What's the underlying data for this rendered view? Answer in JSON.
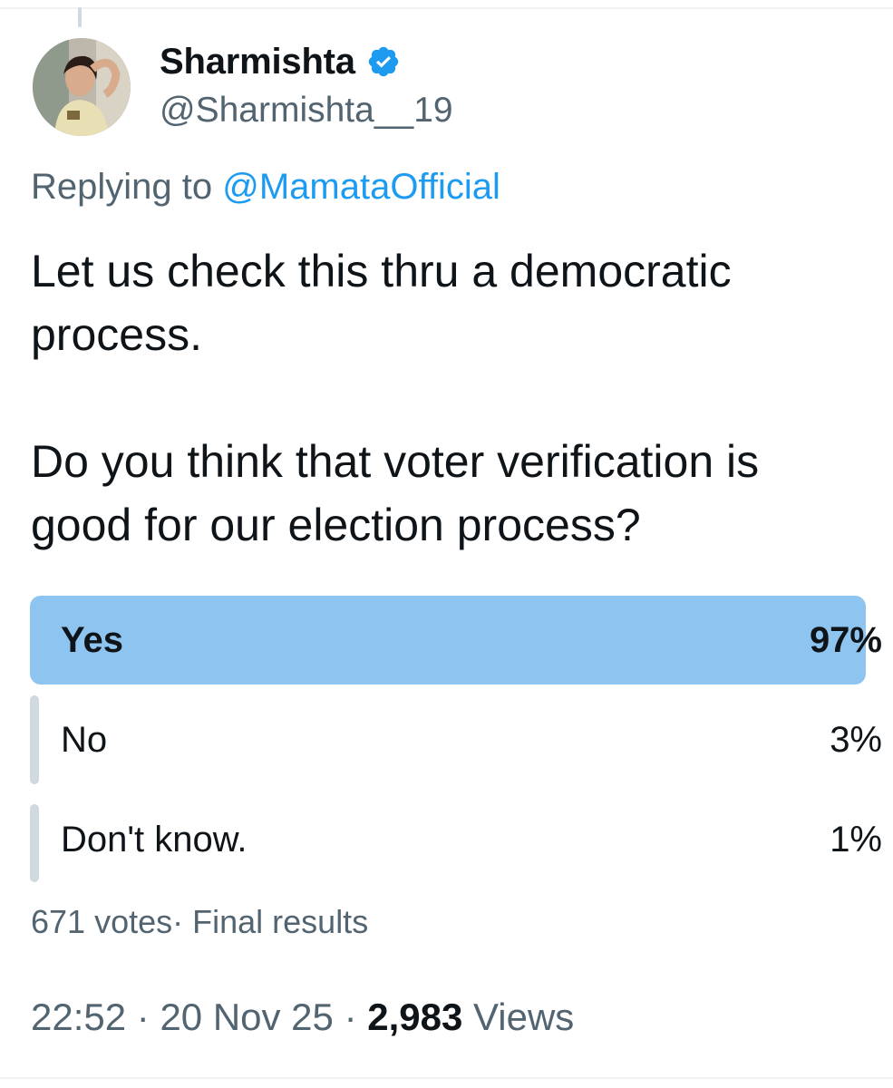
{
  "author": {
    "display_name": "Sharmishta",
    "handle": "@Sharmishta__19",
    "verified_icon": "verified-badge-icon",
    "verified_color": "#1d9bf0"
  },
  "reply": {
    "prefix": "Replying to ",
    "mention": "@MamataOfficial"
  },
  "tweet": {
    "text": "Let us check this thru a democratic\nprocess.\n\nDo you think that voter verification is\ngood for our election process?"
  },
  "poll": {
    "options": [
      {
        "label": "Yes",
        "percent": "97%",
        "share": 0.97,
        "winner": true
      },
      {
        "label": "No",
        "percent": "3%",
        "share": 0.03,
        "winner": false
      },
      {
        "label": "Don't know.",
        "percent": "1%",
        "share": 0.01,
        "winner": false
      }
    ],
    "votes": "671 votes",
    "separator": "· ",
    "status": "Final results",
    "winner_color": "#8ec4f0",
    "other_color": "#cfd9de"
  },
  "meta": {
    "time": "22:52",
    "date": "20 Nov 25",
    "views_count": "2,983",
    "views_label": "Views",
    "dot": " · "
  }
}
